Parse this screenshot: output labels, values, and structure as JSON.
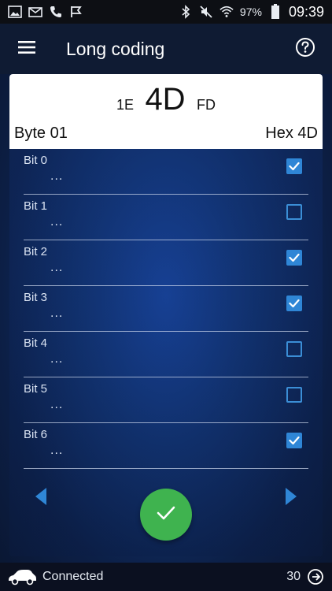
{
  "status_bar": {
    "battery_percent": "97%",
    "time": "09:39",
    "icons": [
      "image-icon",
      "mail-icon",
      "phone-icon",
      "flag-icon",
      "bluetooth-icon",
      "mute-icon",
      "wifi-icon",
      "battery-icon"
    ]
  },
  "app_bar": {
    "title": "Long coding",
    "menu_icon": "menu-icon",
    "help_icon": "help-icon"
  },
  "coding": {
    "prev_hex": "1E",
    "current_hex": "4D",
    "next_hex": "FD",
    "byte_label": "Byte 01",
    "hex_label": "Hex 4D",
    "bits": [
      {
        "name": "Bit 0",
        "desc": "...",
        "checked": true
      },
      {
        "name": "Bit 1",
        "desc": "...",
        "checked": false
      },
      {
        "name": "Bit 2",
        "desc": "...",
        "checked": true
      },
      {
        "name": "Bit 3",
        "desc": "...",
        "checked": true
      },
      {
        "name": "Bit 4",
        "desc": "...",
        "checked": false
      },
      {
        "name": "Bit 5",
        "desc": "...",
        "checked": false
      },
      {
        "name": "Bit 6",
        "desc": "...",
        "checked": true
      }
    ]
  },
  "bottom": {
    "connection": "Connected",
    "count": "30"
  },
  "colors": {
    "accent": "#2f86d6",
    "confirm": "#3fb34f",
    "background": "#123574"
  }
}
